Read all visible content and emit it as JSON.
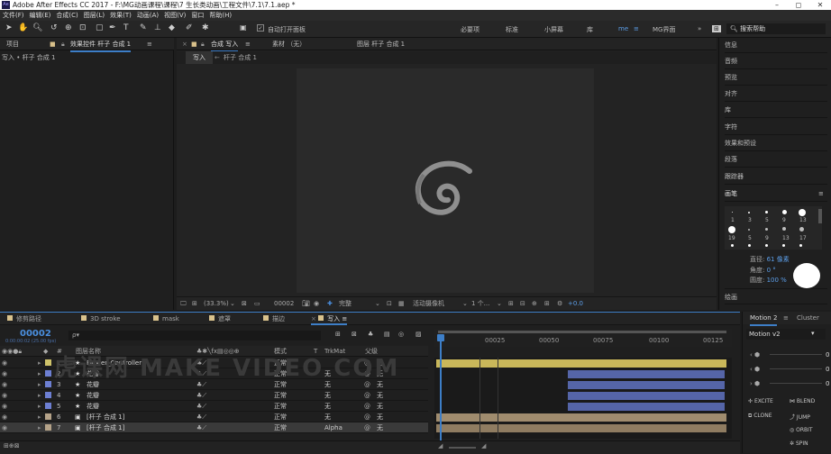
{
  "window": {
    "title": "Adobe After Effects CC 2017 - F:\\MG动画课程\\课程\\7 生长类动画\\工程文件\\7.1\\7.1.aep *",
    "logo": "Ae",
    "minimize": "–",
    "maximize": "◻",
    "close": "✕"
  },
  "menu": [
    "文件(F)",
    "编辑(E)",
    "合成(C)",
    "图层(L)",
    "效果(T)",
    "动画(A)",
    "视图(V)",
    "窗口",
    "帮助(H)"
  ],
  "toolbar": {
    "auto_open": "自动打开面板",
    "workspaces": [
      "必要项",
      "标准",
      "小屏幕",
      "库",
      "me",
      "MG界面"
    ],
    "active_workspace": "me",
    "search_placeholder": "搜索帮助"
  },
  "project_panel": {
    "tab_project": "项目",
    "tab_effects": "效果控件 杆子 合成 1",
    "breadcrumb": "写入 • 杆子 合成 1"
  },
  "comp_panel": {
    "tab_comp": "合成 写入",
    "tab_footage": "素材 （无）",
    "tab_layer": "图层 杆子 合成 1",
    "subtab1": "写入",
    "subtab2": "杆子 合成 1",
    "zoom": "(33.3%)",
    "time": "00002",
    "quality": "完整",
    "camera": "活动摄像机",
    "views": "1 个...",
    "exposure": "+0.0"
  },
  "right_panel": {
    "items": [
      "信息",
      "音频",
      "预览",
      "对齐",
      "库",
      "字符",
      "效果和预设",
      "段落",
      "跟踪器"
    ],
    "brush_title": "画笔",
    "brush_sizes": [
      "1",
      "3",
      "5",
      "9",
      "13",
      "19",
      "5",
      "9",
      "13",
      "17"
    ],
    "diameter_label": "直径:",
    "diameter_value": "61 像素",
    "angle_label": "角度:",
    "angle_value": "0 °",
    "roundness_label": "圆度:",
    "roundness_value": "100 %",
    "paint_title": "绘画"
  },
  "timeline": {
    "tabs": [
      "修剪路径",
      "3D stroke",
      "mask",
      "遮罩",
      "描边",
      "写入"
    ],
    "active_tab": "写入",
    "timecode": "00002",
    "frame_info": "0:00:00:02 (25.00 fps)",
    "search_placeholder": "ρ▾",
    "col_name": "图层名称",
    "col_mode": "模式",
    "col_t": "T",
    "col_trkmat": "TrkMat",
    "col_parent": "父级",
    "ruler": [
      "00025",
      "00050",
      "00075",
      "00100",
      "00125"
    ],
    "layers": [
      {
        "idx": "1",
        "name": "Flower_Controller",
        "mode": "正常",
        "trk": "",
        "parent": "无",
        "color": "#cfc36a",
        "type": "★"
      },
      {
        "idx": "2",
        "name": "花瓣",
        "mode": "正常",
        "trk": "无",
        "parent": "无",
        "color": "#6d7fd2",
        "type": "★"
      },
      {
        "idx": "3",
        "name": "花瓣",
        "mode": "正常",
        "trk": "无",
        "parent": "无",
        "color": "#6d7fd2",
        "type": "★"
      },
      {
        "idx": "4",
        "name": "花瓣",
        "mode": "正常",
        "trk": "无",
        "parent": "无",
        "color": "#6d7fd2",
        "type": "★"
      },
      {
        "idx": "5",
        "name": "花瓣",
        "mode": "正常",
        "trk": "无",
        "parent": "无",
        "color": "#6d7fd2",
        "type": "★"
      },
      {
        "idx": "6",
        "name": "[杆子 合成 1]",
        "mode": "正常",
        "trk": "无",
        "parent": "无",
        "color": "#b5a389",
        "type": "▣"
      },
      {
        "idx": "7",
        "name": "[杆子 合成 1]",
        "mode": "正常",
        "trk": "Alpha",
        "parent": "无",
        "color": "#b5a389",
        "type": "▣"
      }
    ]
  },
  "motion": {
    "tab1": "Motion 2",
    "tab2": "Cluster",
    "version": "Motion v2",
    "values": [
      "0",
      "0",
      "0"
    ],
    "btn_excite": "EXCITE",
    "btn_blend": "BLEND",
    "btn_clone": "CLONE",
    "btn_jump": "JUMP",
    "btn_orbit": "ORBIT",
    "btn_spin": "SPIN"
  },
  "watermark": "虎课网 MAKE VIDEO COM",
  "colors": {
    "accent": "#3d7ec7",
    "timecode": "#4a8fe0",
    "layer_yellow": "#c9b75a",
    "layer_blue": "#5565a8",
    "layer_tan": "#a08c6e"
  }
}
